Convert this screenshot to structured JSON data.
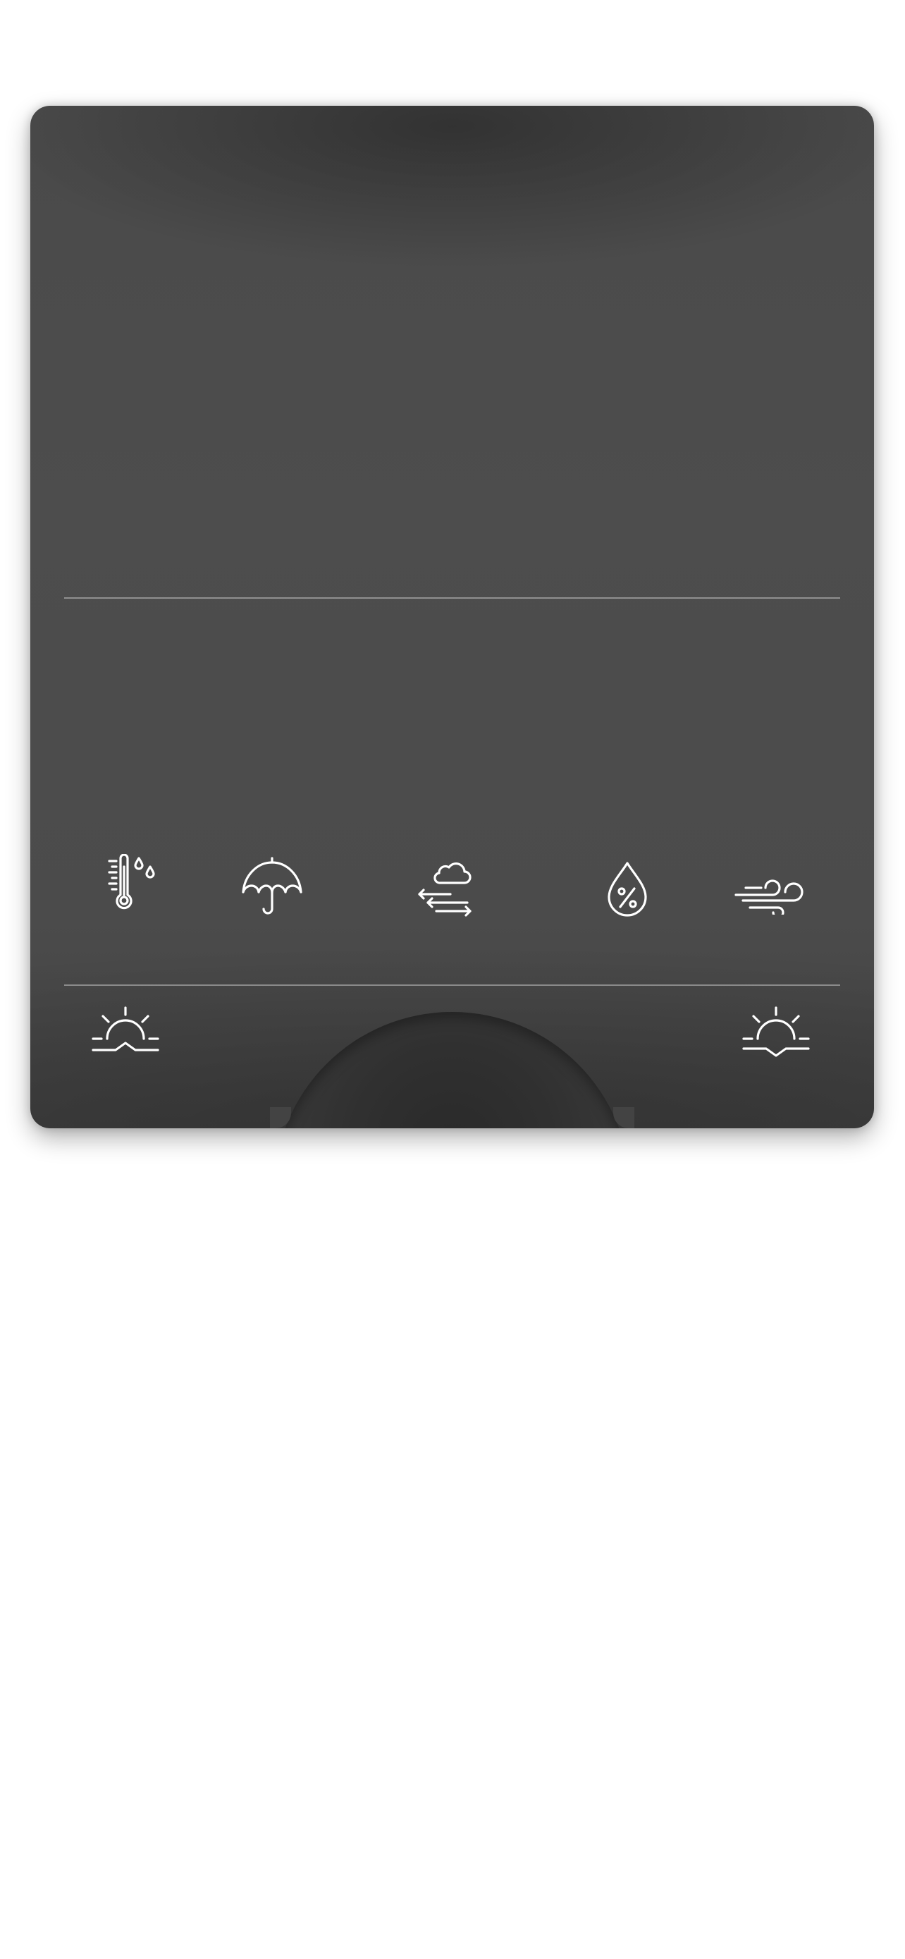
{
  "widget": {
    "icons": {
      "temperature": "thermometer-drops-icon",
      "precipitation": "umbrella-icon",
      "fog": "cloud-fog-icon",
      "humidity": "humidity-drop-icon",
      "wind": "wind-icon",
      "sunrise": "sunrise-icon",
      "sunset": "sunset-icon"
    },
    "colors": {
      "card_background": "#4b4b4b",
      "icon_stroke": "#ffffff",
      "divider": "#8a8a8a",
      "page_background": "#ffffff"
    }
  }
}
